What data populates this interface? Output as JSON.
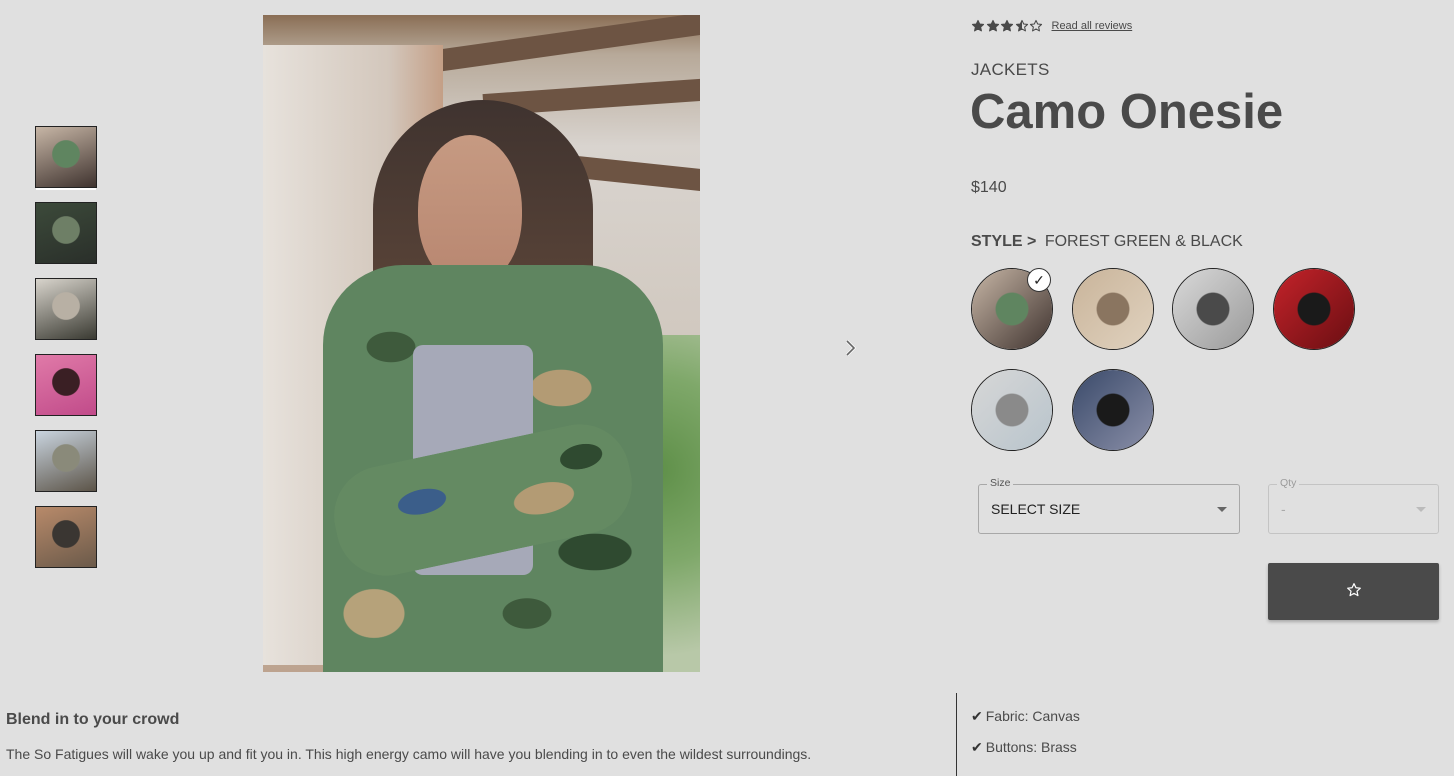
{
  "thumbnails": [
    {
      "name": "thumb-camo-woman",
      "colors": [
        "#c7b6a6",
        "#5f8560",
        "#3f332f"
      ],
      "active": true
    },
    {
      "name": "thumb-camo-woman-2",
      "colors": [
        "#3c4a3a",
        "#6e7f66",
        "#2a2f2a"
      ],
      "active": false
    },
    {
      "name": "thumb-stairs",
      "colors": [
        "#d8d4cc",
        "#b8b0a4",
        "#3a3a32"
      ],
      "active": false
    },
    {
      "name": "thumb-pink-portrait",
      "colors": [
        "#e07aa8",
        "#3a1f24",
        "#c14b8a"
      ],
      "active": false
    },
    {
      "name": "thumb-street",
      "colors": [
        "#c9d4df",
        "#8a8a7a",
        "#5c5448"
      ],
      "active": false
    },
    {
      "name": "thumb-window",
      "colors": [
        "#b88a6a",
        "#3a3632",
        "#6b5a4a"
      ],
      "active": false
    }
  ],
  "product": {
    "rating_value": 3.5,
    "rating_max": 5,
    "reviews_link": "Read all reviews",
    "category": "JACKETS",
    "name": "Camo Onesie",
    "price": "$140",
    "style_label": "STYLE >",
    "style_value": "FOREST GREEN & BLACK"
  },
  "styles": [
    {
      "name": "style-forest-green-black",
      "colors": [
        "#c7b6a6",
        "#5f8560",
        "#3f332f"
      ],
      "selected": true
    },
    {
      "name": "style-sand",
      "colors": [
        "#c9b49a",
        "#8a7560",
        "#e0d2bf"
      ],
      "selected": false
    },
    {
      "name": "style-industrial",
      "colors": [
        "#d9d9d9",
        "#4a4a4a",
        "#9a9a9a"
      ],
      "selected": false
    },
    {
      "name": "style-red-black",
      "colors": [
        "#c4232a",
        "#1a1a1a",
        "#6a0e12"
      ],
      "selected": false
    },
    {
      "name": "style-cloud-grey",
      "colors": [
        "#d7d7d7",
        "#8a8a8a",
        "#b8c4cc"
      ],
      "selected": false
    },
    {
      "name": "style-graffiti",
      "colors": [
        "#3a4a6a",
        "#1a1a1a",
        "#8a8fa8"
      ],
      "selected": false
    }
  ],
  "selection_check": "✓",
  "size_field": {
    "legend": "Size",
    "value": "SELECT SIZE"
  },
  "qty_field": {
    "legend": "Qty",
    "value": "-"
  },
  "description": {
    "title": "Blend in to your crowd",
    "text": "The So Fatigues will wake you up and fit you in. This high energy camo will have you blending in to even the wildest surroundings."
  },
  "features": [
    {
      "tick": "✔",
      "text": "Fabric: Canvas"
    },
    {
      "tick": "✔",
      "text": "Buttons: Brass"
    }
  ],
  "icons": {
    "next": "chevron-right-icon",
    "favorite": "star-outline-icon"
  }
}
